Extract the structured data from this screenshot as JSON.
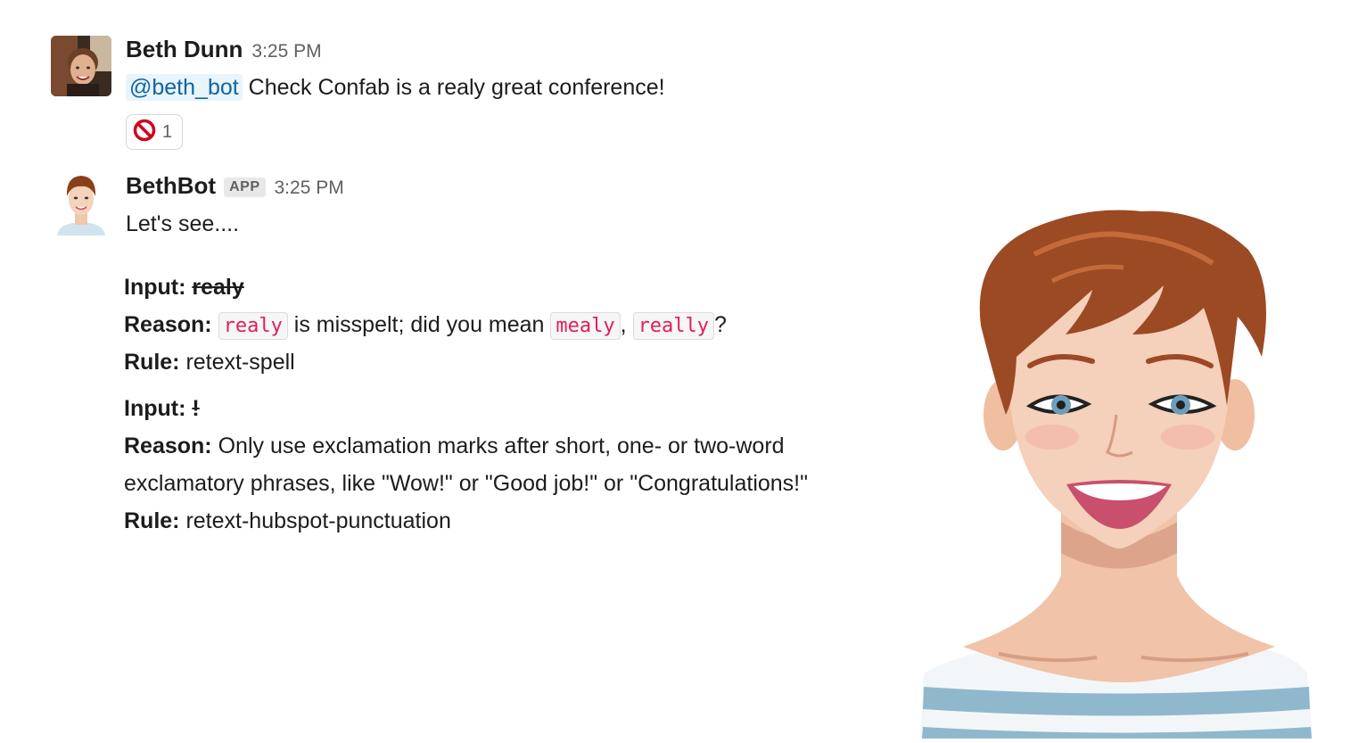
{
  "messages": [
    {
      "sender": "Beth Dunn",
      "time": "3:25 PM",
      "mention": "@beth_bot",
      "text": "Check Confab is a realy great conference!",
      "reaction": {
        "icon": "no-entry-icon",
        "count": "1"
      }
    },
    {
      "sender": "BethBot",
      "badge": "APP",
      "time": "3:25 PM",
      "text": "Let's see....",
      "results": [
        {
          "input_label": "Input:",
          "input": "realy",
          "reason_label": "Reason:",
          "reason_code": "realy",
          "reason_text": "is misspelt; did you mean",
          "suggestions": [
            "mealy",
            "really"
          ],
          "sep": ",",
          "end": "?",
          "rule_label": "Rule:",
          "rule": "retext-spell"
        },
        {
          "input_label": "Input:",
          "input": "!",
          "reason_label": "Reason:",
          "reason_line1": "Only use exclamation marks after short, one- or two-word",
          "reason_line2": "exclamatory phrases, like \"Wow!\" or \"Good job!\" or \"Congratulations!\"",
          "rule_label": "Rule:",
          "rule": "retext-hubspot-punctuation"
        }
      ]
    }
  ],
  "colors": {
    "mention": "#1264a3",
    "code": "#e01e5a",
    "reaction_icon": "#d0021b"
  }
}
